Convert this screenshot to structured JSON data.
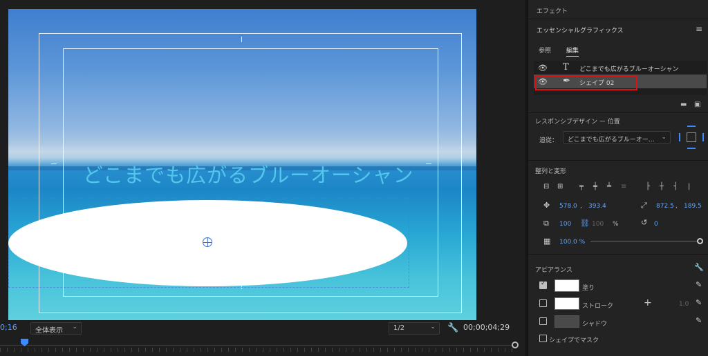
{
  "monitor": {
    "title_overlay": "どこまでも広がるブルーオーシャン",
    "timecode_left": "0;16",
    "zoom_select": "全体表示",
    "resolution_select": "1/2",
    "timecode_right": "00;00;04;29"
  },
  "panel": {
    "effects_label": "エフェクト",
    "essential_graphics_label": "エッセンシャルグラフィックス",
    "tabs": [
      "参照",
      "編集"
    ],
    "active_tab": "編集",
    "layers": [
      {
        "icon": "text-icon",
        "name": "どこまでも広がるブルーオーシャン"
      },
      {
        "icon": "pen-icon",
        "name": "シェイプ 02"
      }
    ],
    "responsive": {
      "title": "レスポンシブデザイン ー 位置",
      "follow_label": "追従：",
      "follow_value": "どこまでも広がるブルーオー…"
    },
    "align": {
      "title": "整列と変形",
      "position_x": "578.0",
      "position_y": "393.4",
      "anchor_x": "872.5",
      "anchor_y": "189.5",
      "scale": "100",
      "scale_h": "100",
      "percent": "%",
      "rotation": "0",
      "opacity": "100.0 %"
    },
    "appearance": {
      "title": "アピアランス",
      "fill_label": "塗り",
      "fill_checked": true,
      "fill_color": "#ffffff",
      "stroke_label": "ストローク",
      "stroke_checked": false,
      "stroke_color": "#ffffff",
      "stroke_width": "1.0",
      "shadow_label": "シャドウ",
      "shadow_checked": false,
      "shadow_color": "#4a4a4a",
      "mask_label": "シェイプでマスク"
    }
  },
  "colors": {
    "accent": "#3d8bff",
    "highlight_box": "#e01010",
    "title_text": "#53c6ec"
  }
}
